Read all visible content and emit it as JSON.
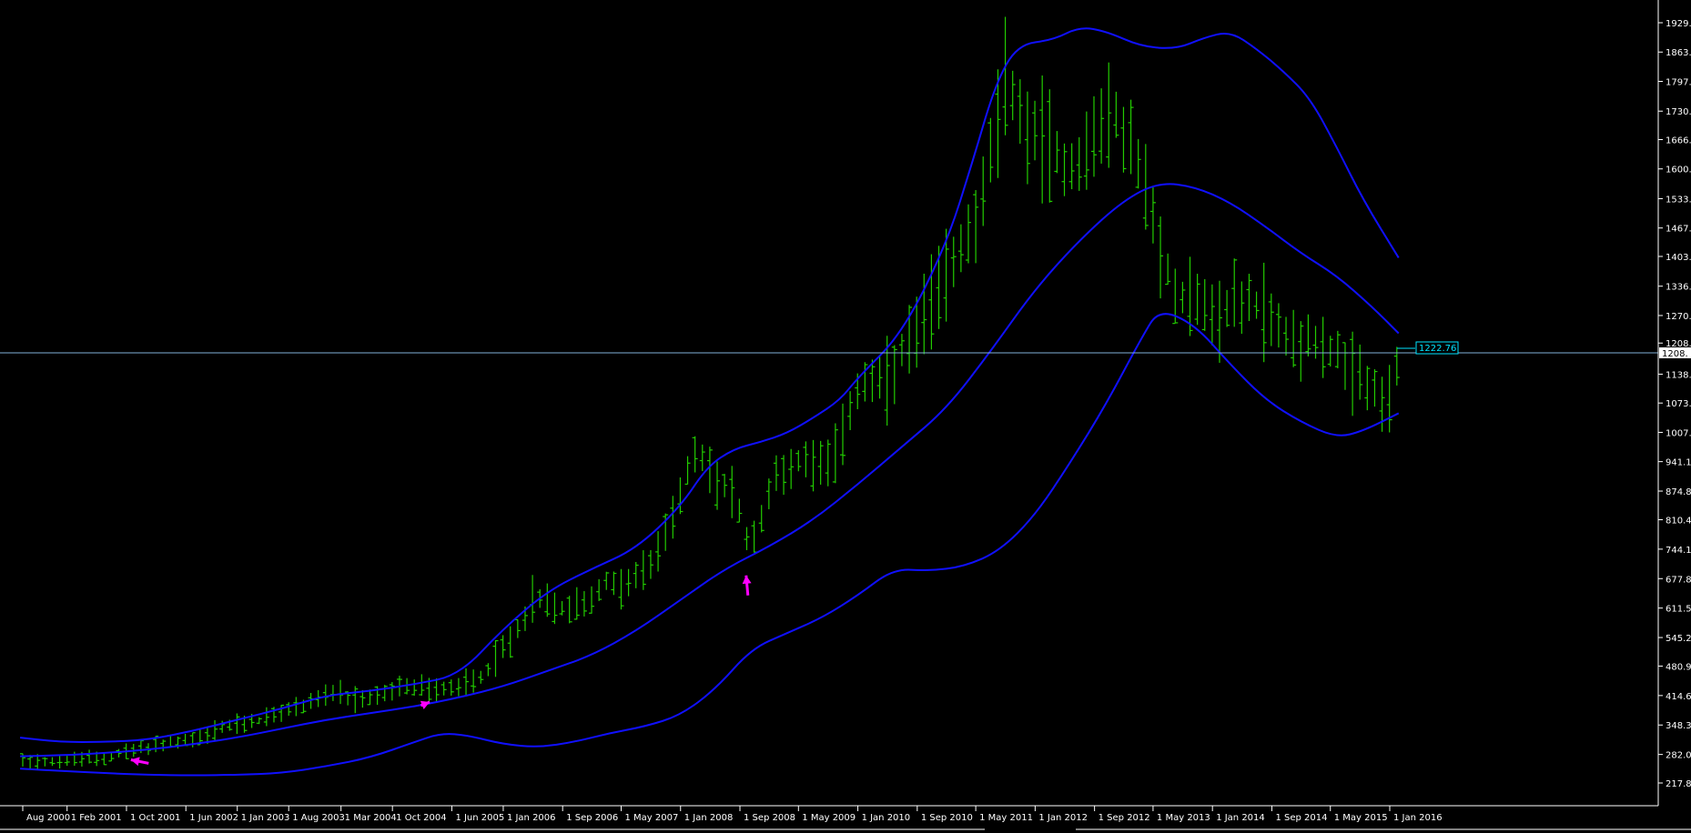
{
  "chart_title": "",
  "colors": {
    "background": "#000000",
    "bars": "#22cc00",
    "bands": "#1010ff",
    "current_line": "#7fb0d8",
    "current_label": "#00e5ff",
    "axis_text": "#ffffff",
    "arrows": "#ff00ff",
    "bottom_bar": "#ffffff"
  },
  "price_axis": {
    "labels": [
      "1929.",
      "1863.",
      "1797.",
      "1730.",
      "1666.",
      "1600.",
      "1533.",
      "1467.",
      "1403.",
      "1336.",
      "1270.",
      "1208.",
      "1138.",
      "1073.",
      "1007.",
      "941.1",
      "874.8",
      "810.4",
      "744.1",
      "677.8",
      "611.5",
      "545.2",
      "480.9",
      "414.6",
      "348.3",
      "282.0",
      "217.8"
    ],
    "values": [
      1929,
      1863,
      1797,
      1730,
      1666,
      1600,
      1533,
      1467,
      1403,
      1336,
      1270,
      1208,
      1138,
      1073,
      1007,
      941.1,
      874.8,
      810.4,
      744.1,
      677.8,
      611.5,
      545.2,
      480.9,
      414.6,
      348.3,
      282.0,
      217.8
    ]
  },
  "current_price": {
    "label": "1222.76",
    "value": 1222.76,
    "axis_label": "1208."
  },
  "chart_data": {
    "type": "line",
    "title": "",
    "xlabel": "",
    "ylabel": "",
    "ylim": [
      200,
      1950
    ],
    "x_range": [
      2000.55,
      2017.35
    ],
    "x_labels": [
      {
        "text": "Aug 2000",
        "t": 2000.58
      },
      {
        "text": "1 Feb 2001",
        "t": 2001.08
      },
      {
        "text": "1 Oct 2001",
        "t": 2001.75
      },
      {
        "text": "1 Jun 2002",
        "t": 2002.42
      },
      {
        "text": "1 Jan 2003",
        "t": 2003.0
      },
      {
        "text": "1 Aug 2003",
        "t": 2003.58
      },
      {
        "text": "1 Mar 2004",
        "t": 2004.17
      },
      {
        "text": "1 Oct 2004",
        "t": 2004.75
      },
      {
        "text": "1 Jun 2005",
        "t": 2005.42
      },
      {
        "text": "1 Jan 2006",
        "t": 2006.0
      },
      {
        "text": "1 Sep 2006",
        "t": 2006.67
      },
      {
        "text": "1 May 2007",
        "t": 2007.33
      },
      {
        "text": "1 Jan 2008",
        "t": 2008.0
      },
      {
        "text": "1 Sep 2008",
        "t": 2008.67
      },
      {
        "text": "1 May 2009",
        "t": 2009.33
      },
      {
        "text": "1 Jan 2010",
        "t": 2010.0
      },
      {
        "text": "1 Sep 2010",
        "t": 2010.67
      },
      {
        "text": "1 May 2011",
        "t": 2011.33
      },
      {
        "text": "1 Jan 2012",
        "t": 2012.0
      },
      {
        "text": "1 Sep 2012",
        "t": 2012.67
      },
      {
        "text": "1 May 2013",
        "t": 2013.33
      },
      {
        "text": "1 Jan 2014",
        "t": 2014.0
      },
      {
        "text": "1 Sep 2014",
        "t": 2014.67
      },
      {
        "text": "1 May 2015",
        "t": 2015.33
      },
      {
        "text": "1 Jan 2016",
        "t": 2016.0
      }
    ],
    "price_keypoints": [
      [
        2000.55,
        272
      ],
      [
        2001.0,
        266
      ],
      [
        2001.5,
        276
      ],
      [
        2001.9,
        295
      ],
      [
        2002.3,
        310
      ],
      [
        2002.6,
        318
      ],
      [
        2002.85,
        345
      ],
      [
        2003.2,
        355
      ],
      [
        2003.5,
        375
      ],
      [
        2003.75,
        395
      ],
      [
        2004.05,
        420
      ],
      [
        2004.3,
        400
      ],
      [
        2004.6,
        415
      ],
      [
        2004.9,
        435
      ],
      [
        2005.2,
        428
      ],
      [
        2005.45,
        432
      ],
      [
        2005.7,
        450
      ],
      [
        2005.95,
        505
      ],
      [
        2006.15,
        560
      ],
      [
        2006.35,
        640
      ],
      [
        2006.6,
        610
      ],
      [
        2006.9,
        620
      ],
      [
        2007.15,
        665
      ],
      [
        2007.4,
        665
      ],
      [
        2007.6,
        690
      ],
      [
        2007.8,
        760
      ],
      [
        2008.0,
        880
      ],
      [
        2008.2,
        960
      ],
      [
        2008.4,
        900
      ],
      [
        2008.6,
        860
      ],
      [
        2008.8,
        740
      ],
      [
        2009.0,
        880
      ],
      [
        2009.2,
        930
      ],
      [
        2009.4,
        950
      ],
      [
        2009.6,
        950
      ],
      [
        2009.8,
        960
      ],
      [
        2009.95,
        1100
      ],
      [
        2010.1,
        1120
      ],
      [
        2010.3,
        1110
      ],
      [
        2010.5,
        1180
      ],
      [
        2010.7,
        1245
      ],
      [
        2010.95,
        1340
      ],
      [
        2011.15,
        1430
      ],
      [
        2011.35,
        1500
      ],
      [
        2011.55,
        1660
      ],
      [
        2011.7,
        1820
      ],
      [
        2011.85,
        1700
      ],
      [
        2012.0,
        1680
      ],
      [
        2012.2,
        1650
      ],
      [
        2012.4,
        1600
      ],
      [
        2012.6,
        1640
      ],
      [
        2012.8,
        1730
      ],
      [
        2013.0,
        1680
      ],
      [
        2013.2,
        1600
      ],
      [
        2013.4,
        1410
      ],
      [
        2013.6,
        1320
      ],
      [
        2013.8,
        1320
      ],
      [
        2014.0,
        1260
      ],
      [
        2014.2,
        1300
      ],
      [
        2014.4,
        1300
      ],
      [
        2014.6,
        1280
      ],
      [
        2014.8,
        1230
      ],
      [
        2015.0,
        1210
      ],
      [
        2015.2,
        1220
      ],
      [
        2015.4,
        1180
      ],
      [
        2015.6,
        1120
      ],
      [
        2015.8,
        1120
      ],
      [
        2015.95,
        1060
      ],
      [
        2016.05,
        1100
      ],
      [
        2016.15,
        1240
      ]
    ],
    "series": [
      {
        "name": "",
        "points": [
          [
            2000.55,
            320
          ],
          [
            2001.0,
            310
          ],
          [
            2001.5,
            310
          ],
          [
            2002.0,
            315
          ],
          [
            2002.5,
            335
          ],
          [
            2003.0,
            360
          ],
          [
            2003.5,
            385
          ],
          [
            2004.0,
            415
          ],
          [
            2004.5,
            425
          ],
          [
            2005.0,
            440
          ],
          [
            2005.5,
            460
          ],
          [
            2006.0,
            565
          ],
          [
            2006.5,
            650
          ],
          [
            2007.0,
            700
          ],
          [
            2007.5,
            745
          ],
          [
            2008.0,
            840
          ],
          [
            2008.3,
            930
          ],
          [
            2008.6,
            970
          ],
          [
            2008.9,
            985
          ],
          [
            2009.2,
            1005
          ],
          [
            2009.5,
            1040
          ],
          [
            2009.8,
            1080
          ],
          [
            2010.0,
            1130
          ],
          [
            2010.5,
            1230
          ],
          [
            2011.0,
            1430
          ],
          [
            2011.3,
            1620
          ],
          [
            2011.55,
            1790
          ],
          [
            2011.8,
            1880
          ],
          [
            2012.2,
            1890
          ],
          [
            2012.5,
            1920
          ],
          [
            2012.8,
            1910
          ],
          [
            2013.2,
            1875
          ],
          [
            2013.6,
            1870
          ],
          [
            2013.9,
            1895
          ],
          [
            2014.2,
            1910
          ],
          [
            2014.5,
            1870
          ],
          [
            2014.8,
            1820
          ],
          [
            2015.1,
            1760
          ],
          [
            2015.4,
            1650
          ],
          [
            2015.7,
            1530
          ],
          [
            2016.1,
            1400
          ]
        ]
      },
      {
        "name": "",
        "points": [
          [
            2000.55,
            278
          ],
          [
            2001.0,
            280
          ],
          [
            2001.5,
            285
          ],
          [
            2002.0,
            293
          ],
          [
            2002.5,
            305
          ],
          [
            2003.0,
            320
          ],
          [
            2003.5,
            340
          ],
          [
            2004.0,
            360
          ],
          [
            2004.5,
            375
          ],
          [
            2005.0,
            390
          ],
          [
            2005.5,
            410
          ],
          [
            2006.0,
            435
          ],
          [
            2006.5,
            470
          ],
          [
            2007.0,
            505
          ],
          [
            2007.5,
            560
          ],
          [
            2008.0,
            630
          ],
          [
            2008.5,
            700
          ],
          [
            2009.0,
            750
          ],
          [
            2009.5,
            810
          ],
          [
            2010.0,
            890
          ],
          [
            2010.5,
            975
          ],
          [
            2011.0,
            1060
          ],
          [
            2011.5,
            1190
          ],
          [
            2012.0,
            1330
          ],
          [
            2012.5,
            1440
          ],
          [
            2013.0,
            1530
          ],
          [
            2013.4,
            1570
          ],
          [
            2013.8,
            1560
          ],
          [
            2014.2,
            1525
          ],
          [
            2014.6,
            1470
          ],
          [
            2015.0,
            1410
          ],
          [
            2015.4,
            1360
          ],
          [
            2015.8,
            1290
          ],
          [
            2016.1,
            1230
          ]
        ]
      },
      {
        "name": "",
        "points": [
          [
            2000.55,
            250
          ],
          [
            2001.0,
            245
          ],
          [
            2001.5,
            240
          ],
          [
            2002.0,
            236
          ],
          [
            2002.5,
            235
          ],
          [
            2003.0,
            236
          ],
          [
            2003.5,
            240
          ],
          [
            2004.0,
            255
          ],
          [
            2004.5,
            275
          ],
          [
            2005.0,
            310
          ],
          [
            2005.3,
            330
          ],
          [
            2005.6,
            325
          ],
          [
            2006.0,
            305
          ],
          [
            2006.4,
            298
          ],
          [
            2006.8,
            310
          ],
          [
            2007.2,
            330
          ],
          [
            2007.6,
            345
          ],
          [
            2008.0,
            370
          ],
          [
            2008.4,
            430
          ],
          [
            2008.8,
            520
          ],
          [
            2009.2,
            555
          ],
          [
            2009.6,
            590
          ],
          [
            2010.0,
            640
          ],
          [
            2010.4,
            700
          ],
          [
            2010.8,
            695
          ],
          [
            2011.2,
            705
          ],
          [
            2011.6,
            740
          ],
          [
            2012.0,
            820
          ],
          [
            2012.4,
            940
          ],
          [
            2012.8,
            1070
          ],
          [
            2013.2,
            1220
          ],
          [
            2013.4,
            1285
          ],
          [
            2013.8,
            1250
          ],
          [
            2014.2,
            1160
          ],
          [
            2014.6,
            1080
          ],
          [
            2015.0,
            1030
          ],
          [
            2015.4,
            995
          ],
          [
            2015.7,
            1010
          ],
          [
            2016.1,
            1050
          ]
        ]
      }
    ],
    "annotations": [
      {
        "type": "arrow",
        "text": "",
        "from": [
          2002.0,
          262
        ],
        "to": [
          2001.8,
          270
        ]
      },
      {
        "type": "arrow",
        "text": "",
        "from": [
          2005.07,
          392
        ],
        "to": [
          2005.17,
          400
        ]
      },
      {
        "type": "arrow",
        "text": "",
        "from": [
          2008.76,
          640
        ],
        "to": [
          2008.74,
          685
        ]
      }
    ]
  }
}
